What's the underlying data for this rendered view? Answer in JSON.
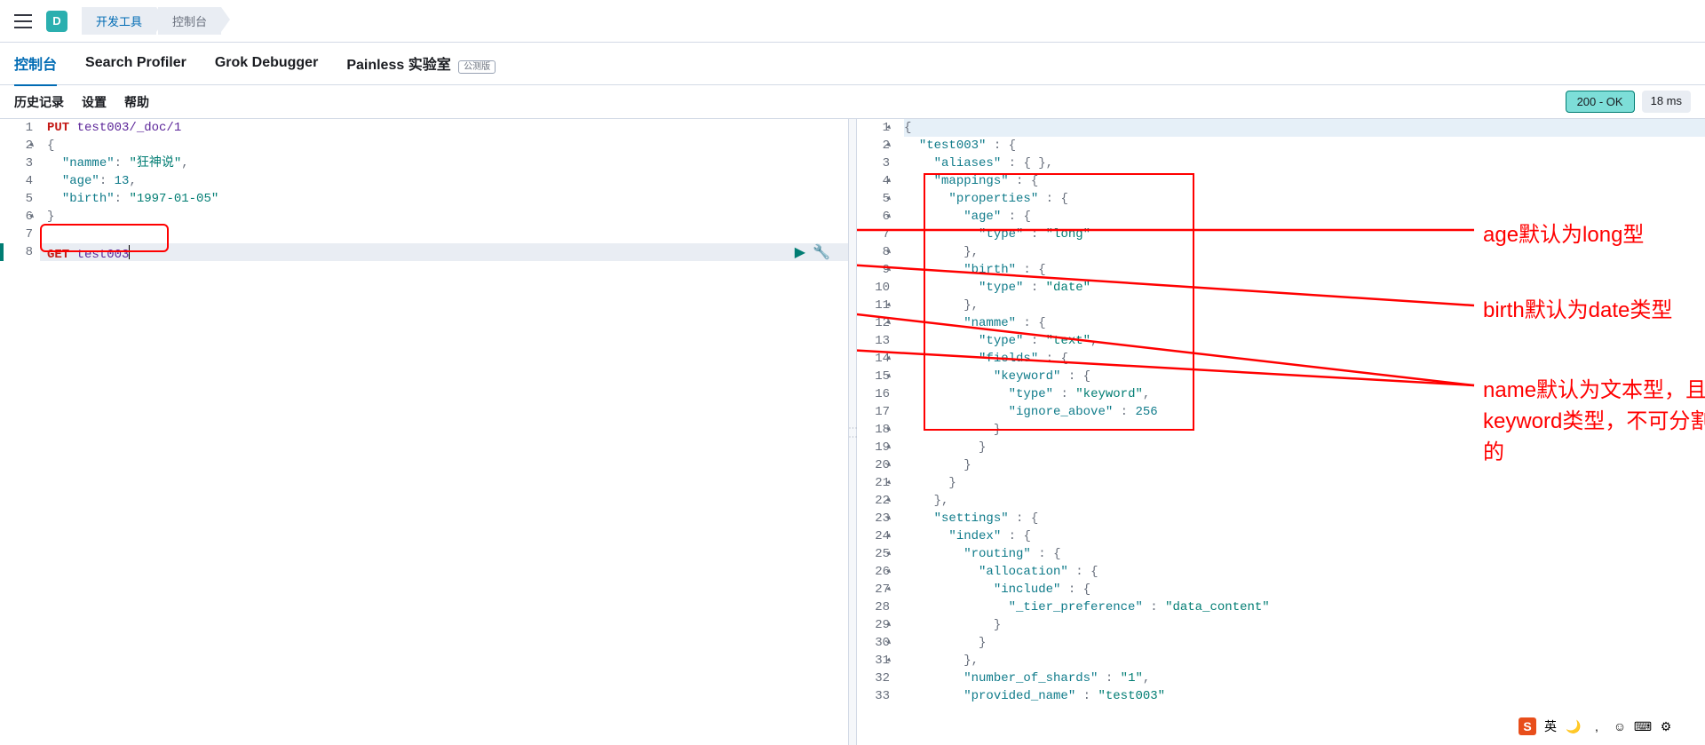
{
  "header": {
    "logo_letter": "D",
    "breadcrumbs": [
      "开发工具",
      "控制台"
    ]
  },
  "tabs": [
    {
      "label": "控制台",
      "active": true
    },
    {
      "label": "Search Profiler",
      "active": false
    },
    {
      "label": "Grok Debugger",
      "active": false
    },
    {
      "label": "Painless 实验室",
      "active": false,
      "beta": "公测版"
    }
  ],
  "sub_menu": [
    "历史记录",
    "设置",
    "帮助"
  ],
  "status": {
    "code": "200 - OK",
    "time": "18 ms"
  },
  "request_editor": {
    "lines": [
      {
        "n": 1,
        "tokens": [
          {
            "t": "PUT ",
            "c": "method"
          },
          {
            "t": "test003/_doc/1",
            "c": "url"
          }
        ]
      },
      {
        "n": 2,
        "tokens": [
          {
            "t": "{",
            "c": "brace"
          }
        ],
        "fold": true
      },
      {
        "n": 3,
        "tokens": [
          {
            "t": "  ",
            "c": ""
          },
          {
            "t": "\"namme\"",
            "c": "key"
          },
          {
            "t": ": ",
            "c": "punct"
          },
          {
            "t": "\"狂神说\"",
            "c": "string"
          },
          {
            "t": ",",
            "c": "punct"
          }
        ]
      },
      {
        "n": 4,
        "tokens": [
          {
            "t": "  ",
            "c": ""
          },
          {
            "t": "\"age\"",
            "c": "key"
          },
          {
            "t": ": ",
            "c": "punct"
          },
          {
            "t": "13",
            "c": "number"
          },
          {
            "t": ",",
            "c": "punct"
          }
        ]
      },
      {
        "n": 5,
        "tokens": [
          {
            "t": "  ",
            "c": ""
          },
          {
            "t": "\"birth\"",
            "c": "key"
          },
          {
            "t": ": ",
            "c": "punct"
          },
          {
            "t": "\"1997-01-05\"",
            "c": "string"
          }
        ]
      },
      {
        "n": 6,
        "tokens": [
          {
            "t": "}",
            "c": "brace"
          }
        ],
        "fold": true
      },
      {
        "n": 7,
        "tokens": []
      },
      {
        "n": 8,
        "tokens": [
          {
            "t": "GET ",
            "c": "method"
          },
          {
            "t": "test003",
            "c": "url"
          }
        ],
        "active": true
      }
    ]
  },
  "response_editor": {
    "lines": [
      {
        "n": 1,
        "tokens": [
          {
            "t": "{",
            "c": "brace"
          }
        ],
        "fold": true,
        "hl": true
      },
      {
        "n": 2,
        "tokens": [
          {
            "t": "  ",
            "c": ""
          },
          {
            "t": "\"test003\"",
            "c": "key"
          },
          {
            "t": " : ",
            "c": "punct"
          },
          {
            "t": "{",
            "c": "brace"
          }
        ],
        "fold": true
      },
      {
        "n": 3,
        "tokens": [
          {
            "t": "    ",
            "c": ""
          },
          {
            "t": "\"aliases\"",
            "c": "key"
          },
          {
            "t": " : ",
            "c": "punct"
          },
          {
            "t": "{ }",
            "c": "brace"
          },
          {
            "t": ",",
            "c": "punct"
          }
        ]
      },
      {
        "n": 4,
        "tokens": [
          {
            "t": "    ",
            "c": ""
          },
          {
            "t": "\"mappings\"",
            "c": "key"
          },
          {
            "t": " : ",
            "c": "punct"
          },
          {
            "t": "{",
            "c": "brace"
          }
        ],
        "fold": true
      },
      {
        "n": 5,
        "tokens": [
          {
            "t": "      ",
            "c": ""
          },
          {
            "t": "\"properties\"",
            "c": "key"
          },
          {
            "t": " : ",
            "c": "punct"
          },
          {
            "t": "{",
            "c": "brace"
          }
        ],
        "fold": true
      },
      {
        "n": 6,
        "tokens": [
          {
            "t": "        ",
            "c": ""
          },
          {
            "t": "\"age\"",
            "c": "key"
          },
          {
            "t": " : ",
            "c": "punct"
          },
          {
            "t": "{",
            "c": "brace"
          }
        ],
        "fold": true
      },
      {
        "n": 7,
        "tokens": [
          {
            "t": "          ",
            "c": ""
          },
          {
            "t": "\"type\"",
            "c": "key"
          },
          {
            "t": " : ",
            "c": "punct"
          },
          {
            "t": "\"long\"",
            "c": "string"
          }
        ]
      },
      {
        "n": 8,
        "tokens": [
          {
            "t": "        ",
            "c": ""
          },
          {
            "t": "}",
            "c": "brace"
          },
          {
            "t": ",",
            "c": "punct"
          }
        ],
        "fold": true
      },
      {
        "n": 9,
        "tokens": [
          {
            "t": "        ",
            "c": ""
          },
          {
            "t": "\"birth\"",
            "c": "key"
          },
          {
            "t": " : ",
            "c": "punct"
          },
          {
            "t": "{",
            "c": "brace"
          }
        ],
        "fold": true
      },
      {
        "n": 10,
        "tokens": [
          {
            "t": "          ",
            "c": ""
          },
          {
            "t": "\"type\"",
            "c": "key"
          },
          {
            "t": " : ",
            "c": "punct"
          },
          {
            "t": "\"date\"",
            "c": "string"
          }
        ]
      },
      {
        "n": 11,
        "tokens": [
          {
            "t": "        ",
            "c": ""
          },
          {
            "t": "}",
            "c": "brace"
          },
          {
            "t": ",",
            "c": "punct"
          }
        ],
        "fold": true
      },
      {
        "n": 12,
        "tokens": [
          {
            "t": "        ",
            "c": ""
          },
          {
            "t": "\"namme\"",
            "c": "key"
          },
          {
            "t": " : ",
            "c": "punct"
          },
          {
            "t": "{",
            "c": "brace"
          }
        ],
        "fold": true
      },
      {
        "n": 13,
        "tokens": [
          {
            "t": "          ",
            "c": ""
          },
          {
            "t": "\"type\"",
            "c": "key"
          },
          {
            "t": " : ",
            "c": "punct"
          },
          {
            "t": "\"text\"",
            "c": "string"
          },
          {
            "t": ",",
            "c": "punct"
          }
        ]
      },
      {
        "n": 14,
        "tokens": [
          {
            "t": "          ",
            "c": ""
          },
          {
            "t": "\"fields\"",
            "c": "key"
          },
          {
            "t": " : ",
            "c": "punct"
          },
          {
            "t": "{",
            "c": "brace"
          }
        ],
        "fold": true
      },
      {
        "n": 15,
        "tokens": [
          {
            "t": "            ",
            "c": ""
          },
          {
            "t": "\"keyword\"",
            "c": "key"
          },
          {
            "t": " : ",
            "c": "punct"
          },
          {
            "t": "{",
            "c": "brace"
          }
        ],
        "fold": true
      },
      {
        "n": 16,
        "tokens": [
          {
            "t": "              ",
            "c": ""
          },
          {
            "t": "\"type\"",
            "c": "key"
          },
          {
            "t": " : ",
            "c": "punct"
          },
          {
            "t": "\"keyword\"",
            "c": "string"
          },
          {
            "t": ",",
            "c": "punct"
          }
        ]
      },
      {
        "n": 17,
        "tokens": [
          {
            "t": "              ",
            "c": ""
          },
          {
            "t": "\"ignore_above\"",
            "c": "key"
          },
          {
            "t": " : ",
            "c": "punct"
          },
          {
            "t": "256",
            "c": "number"
          }
        ]
      },
      {
        "n": 18,
        "tokens": [
          {
            "t": "            ",
            "c": ""
          },
          {
            "t": "}",
            "c": "brace"
          }
        ],
        "fold": true
      },
      {
        "n": 19,
        "tokens": [
          {
            "t": "          ",
            "c": ""
          },
          {
            "t": "}",
            "c": "brace"
          }
        ],
        "fold": true
      },
      {
        "n": 20,
        "tokens": [
          {
            "t": "        ",
            "c": ""
          },
          {
            "t": "}",
            "c": "brace"
          }
        ],
        "fold": true
      },
      {
        "n": 21,
        "tokens": [
          {
            "t": "      ",
            "c": ""
          },
          {
            "t": "}",
            "c": "brace"
          }
        ],
        "fold": true
      },
      {
        "n": 22,
        "tokens": [
          {
            "t": "    ",
            "c": ""
          },
          {
            "t": "}",
            "c": "brace"
          },
          {
            "t": ",",
            "c": "punct"
          }
        ],
        "fold": true
      },
      {
        "n": 23,
        "tokens": [
          {
            "t": "    ",
            "c": ""
          },
          {
            "t": "\"settings\"",
            "c": "key"
          },
          {
            "t": " : ",
            "c": "punct"
          },
          {
            "t": "{",
            "c": "brace"
          }
        ],
        "fold": true
      },
      {
        "n": 24,
        "tokens": [
          {
            "t": "      ",
            "c": ""
          },
          {
            "t": "\"index\"",
            "c": "key"
          },
          {
            "t": " : ",
            "c": "punct"
          },
          {
            "t": "{",
            "c": "brace"
          }
        ],
        "fold": true
      },
      {
        "n": 25,
        "tokens": [
          {
            "t": "        ",
            "c": ""
          },
          {
            "t": "\"routing\"",
            "c": "key"
          },
          {
            "t": " : ",
            "c": "punct"
          },
          {
            "t": "{",
            "c": "brace"
          }
        ],
        "fold": true
      },
      {
        "n": 26,
        "tokens": [
          {
            "t": "          ",
            "c": ""
          },
          {
            "t": "\"allocation\"",
            "c": "key"
          },
          {
            "t": " : ",
            "c": "punct"
          },
          {
            "t": "{",
            "c": "brace"
          }
        ],
        "fold": true
      },
      {
        "n": 27,
        "tokens": [
          {
            "t": "            ",
            "c": ""
          },
          {
            "t": "\"include\"",
            "c": "key"
          },
          {
            "t": " : ",
            "c": "punct"
          },
          {
            "t": "{",
            "c": "brace"
          }
        ],
        "fold": true
      },
      {
        "n": 28,
        "tokens": [
          {
            "t": "              ",
            "c": ""
          },
          {
            "t": "\"_tier_preference\"",
            "c": "key"
          },
          {
            "t": " : ",
            "c": "punct"
          },
          {
            "t": "\"data_content\"",
            "c": "string"
          }
        ]
      },
      {
        "n": 29,
        "tokens": [
          {
            "t": "            ",
            "c": ""
          },
          {
            "t": "}",
            "c": "brace"
          }
        ],
        "fold": true
      },
      {
        "n": 30,
        "tokens": [
          {
            "t": "          ",
            "c": ""
          },
          {
            "t": "}",
            "c": "brace"
          }
        ],
        "fold": true
      },
      {
        "n": 31,
        "tokens": [
          {
            "t": "        ",
            "c": ""
          },
          {
            "t": "}",
            "c": "brace"
          },
          {
            "t": ",",
            "c": "punct"
          }
        ],
        "fold": true
      },
      {
        "n": 32,
        "tokens": [
          {
            "t": "        ",
            "c": ""
          },
          {
            "t": "\"number_of_shards\"",
            "c": "key"
          },
          {
            "t": " : ",
            "c": "punct"
          },
          {
            "t": "\"1\"",
            "c": "string"
          },
          {
            "t": ",",
            "c": "punct"
          }
        ]
      },
      {
        "n": 33,
        "tokens": [
          {
            "t": "        ",
            "c": ""
          },
          {
            "t": "\"provided_name\"",
            "c": "key"
          },
          {
            "t": " : ",
            "c": "punct"
          },
          {
            "t": "\"test003\"",
            "c": "string"
          }
        ]
      }
    ]
  },
  "annotations": {
    "a1": "age默认为long型",
    "a2": "birth默认为date类型",
    "a3": "name默认为文本型，且是keyword类型，不可分割的"
  },
  "taskbar": {
    "ime": "英"
  }
}
